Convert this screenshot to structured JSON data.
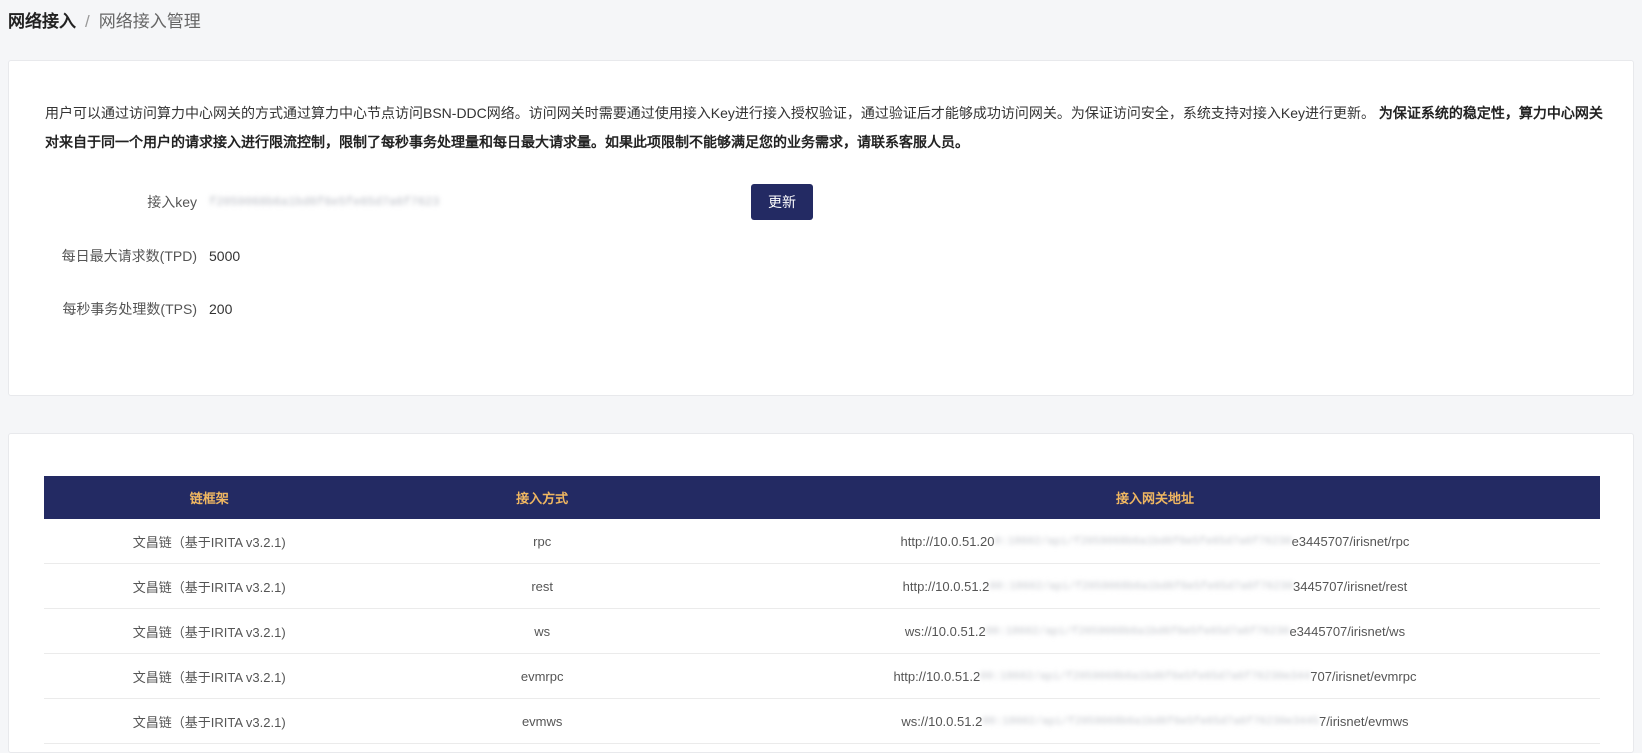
{
  "breadcrumb": {
    "parent": "网络接入",
    "separator": "/",
    "current": "网络接入管理"
  },
  "intro": {
    "text": "用户可以通过访问算力中心网关的方式通过算力中心节点访问BSN-DDC网络。访问网关时需要通过使用接入Key进行接入授权验证，通过验证后才能够成功访问网关。为保证访问安全，系统支持对接入Key进行更新。",
    "strong_text": "为保证系统的稳定性，算力中心网关对来自于同一个用户的请求接入进行限流控制，限制了每秒事务处理量和每日最大请求量。如果此项限制不能够满足您的业务需求，请联系客服人员。"
  },
  "access_key": {
    "label": "接入key",
    "value": "f2059068b6a1bd6f6e5fe65d7a6f7623",
    "update_label": "更新"
  },
  "tpd": {
    "label": "每日最大请求数(TPD)",
    "value": "5000"
  },
  "tps": {
    "label": "每秒事务处理数(TPS)",
    "value": "200"
  },
  "table": {
    "header": {
      "framework": "链框架",
      "method": "接入方式",
      "address": "接入网关地址"
    },
    "rows": [
      {
        "framework": "文昌链（基于IRITA v3.2.1)",
        "method": "rpc",
        "addr_prefix": "http://10.0.51.20",
        "addr_masked": "0:18602/api/f2059068b6a1bd6f6e5fe65d7a6f76230",
        "addr_suffix": "e3445707/irisnet/rpc"
      },
      {
        "framework": "文昌链（基于IRITA v3.2.1)",
        "method": "rest",
        "addr_prefix": "http://10.0.51.2",
        "addr_masked": "00:18602/api/f2059068b6a1bd6f6e5fe65d7a6f76230",
        "addr_suffix": "3445707/irisnet/rest"
      },
      {
        "framework": "文昌链（基于IRITA v3.2.1)",
        "method": "ws",
        "addr_prefix": "ws://10.0.51.2",
        "addr_masked": "00:18602/api/f2059068b6a1bd6f6e5fe65d7a6f76230",
        "addr_suffix": "e3445707/irisnet/ws"
      },
      {
        "framework": "文昌链（基于IRITA v3.2.1)",
        "method": "evmrpc",
        "addr_prefix": "http://10.0.51.2",
        "addr_masked": "00:18602/api/f2059068b6a1bd6f6e5fe65d7a6f76230e344",
        "addr_suffix": "707/irisnet/evmrpc"
      },
      {
        "framework": "文昌链（基于IRITA v3.2.1)",
        "method": "evmws",
        "addr_prefix": "ws://10.0.51.2",
        "addr_masked": "00:18602/api/f2059068b6a1bd6f6e5fe65d7a6f76230e3445",
        "addr_suffix": "7/irisnet/evmws"
      }
    ]
  }
}
